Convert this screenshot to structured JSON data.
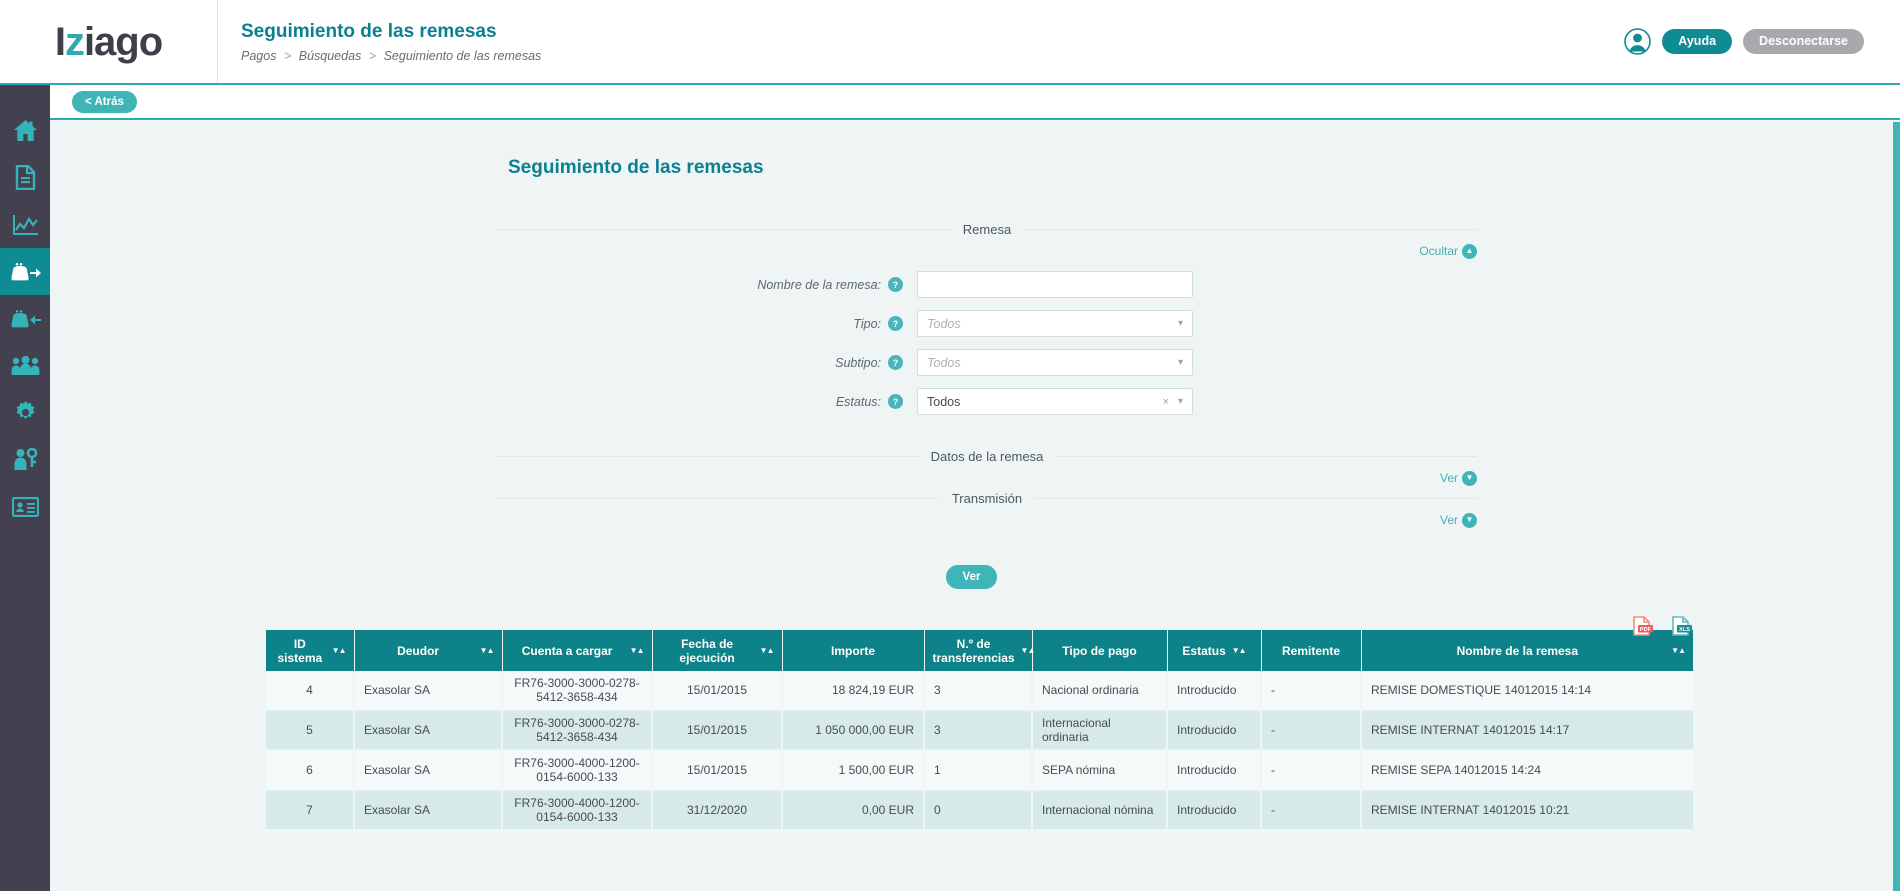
{
  "brand": {
    "logo_part1": "I",
    "logo_z": "z",
    "logo_part2": "iago"
  },
  "header": {
    "title": "Seguimiento de las remesas",
    "breadcrumb": [
      "Pagos",
      "Búsquedas",
      "Seguimiento de las remesas"
    ],
    "breadcrumb_sep": ">",
    "help_label": "Ayuda",
    "logout_label": "Desconectarse"
  },
  "backbar": {
    "back_label": "< Atrás"
  },
  "sidebar": {
    "items": [
      {
        "name": "home-icon",
        "active": false
      },
      {
        "name": "document-icon",
        "active": false
      },
      {
        "name": "chart-icon",
        "active": false
      },
      {
        "name": "payment-out-icon",
        "active": true
      },
      {
        "name": "payment-in-icon",
        "active": false
      },
      {
        "name": "users-icon",
        "active": false
      },
      {
        "name": "gear-icon",
        "active": false
      },
      {
        "name": "user-key-icon",
        "active": false
      },
      {
        "name": "id-card-icon",
        "active": false
      }
    ]
  },
  "page": {
    "title": "Seguimiento de las remesas"
  },
  "sections": {
    "remesa": {
      "title": "Remesa",
      "toggle_label": "Ocultar",
      "toggle_glyph": "▲"
    },
    "datos": {
      "title": "Datos de la remesa",
      "toggle_label": "Ver",
      "toggle_glyph": "▼"
    },
    "transmision": {
      "title": "Transmisión",
      "toggle_label": "Ver",
      "toggle_glyph": "▼"
    }
  },
  "fields": {
    "nombre": {
      "label": "Nombre de la remesa:",
      "value": "",
      "placeholder": "",
      "help": "?"
    },
    "tipo": {
      "label": "Tipo:",
      "value": "Todos",
      "is_placeholder": true,
      "help": "?"
    },
    "subtipo": {
      "label": "Subtipo:",
      "value": "Todos",
      "is_placeholder": true,
      "help": "?"
    },
    "estatus": {
      "label": "Estatus:",
      "value": "Todos",
      "is_placeholder": false,
      "help": "?",
      "clear_glyph": "×"
    }
  },
  "submit": {
    "label": "Ver"
  },
  "export": {
    "pdf_label": "PDF",
    "xls_label": "XLS"
  },
  "table": {
    "columns": [
      {
        "label": "ID sistema",
        "sortable": true
      },
      {
        "label": "Deudor",
        "sortable": true
      },
      {
        "label": "Cuenta a cargar",
        "sortable": true
      },
      {
        "label": "Fecha de ejecución",
        "sortable": true
      },
      {
        "label": "Importe",
        "sortable": false
      },
      {
        "label": "N.º de transferencias",
        "sortable": true
      },
      {
        "label": "Tipo de pago",
        "sortable": false
      },
      {
        "label": "Estatus",
        "sortable": true
      },
      {
        "label": "Remitente",
        "sortable": false
      },
      {
        "label": "Nombre de la remesa",
        "sortable": true
      }
    ],
    "sort_glyph": "▼▲",
    "rows": [
      {
        "id": "4",
        "deudor": "Exasolar SA",
        "cuenta": "FR76-3000-3000-0278-5412-3658-434",
        "fecha": "15/01/2015",
        "importe": "18 824,19 EUR",
        "transferencias": "3",
        "tipo_pago": "Nacional ordinaria",
        "estatus": "Introducido",
        "remitente": "-",
        "nombre": "REMISE DOMESTIQUE 14012015 14:14"
      },
      {
        "id": "5",
        "deudor": "Exasolar SA",
        "cuenta": "FR76-3000-3000-0278-5412-3658-434",
        "fecha": "15/01/2015",
        "importe": "1 050 000,00 EUR",
        "transferencias": "3",
        "tipo_pago": "Internacional ordinaria",
        "estatus": "Introducido",
        "remitente": "-",
        "nombre": "REMISE INTERNAT 14012015 14:17"
      },
      {
        "id": "6",
        "deudor": "Exasolar SA",
        "cuenta": "FR76-3000-4000-1200-0154-6000-133",
        "fecha": "15/01/2015",
        "importe": "1 500,00 EUR",
        "transferencias": "1",
        "tipo_pago": "SEPA nómina",
        "estatus": "Introducido",
        "remitente": "-",
        "nombre": "REMISE SEPA 14012015 14:24"
      },
      {
        "id": "7",
        "deudor": "Exasolar SA",
        "cuenta": "FR76-3000-4000-1200-0154-6000-133",
        "fecha": "31/12/2020",
        "importe": "0,00 EUR",
        "transferencias": "0",
        "tipo_pago": "Internacional nómina",
        "estatus": "Introducido",
        "remitente": "-",
        "nombre": "REMISE INTERNAT 14012015 10:21"
      }
    ]
  },
  "colors": {
    "teal": "#0d8289",
    "teal_light": "#3fb5b8",
    "title_teal": "#0d7f92",
    "sidebar_dark": "#434150",
    "content_bg": "#eef5f4",
    "row_even": "#d7eaea",
    "row_odd": "#f4faf9",
    "logout_gray": "#a8a8ad",
    "pdf_red": "#ef5b67",
    "xls_teal": "#1b8e96"
  }
}
